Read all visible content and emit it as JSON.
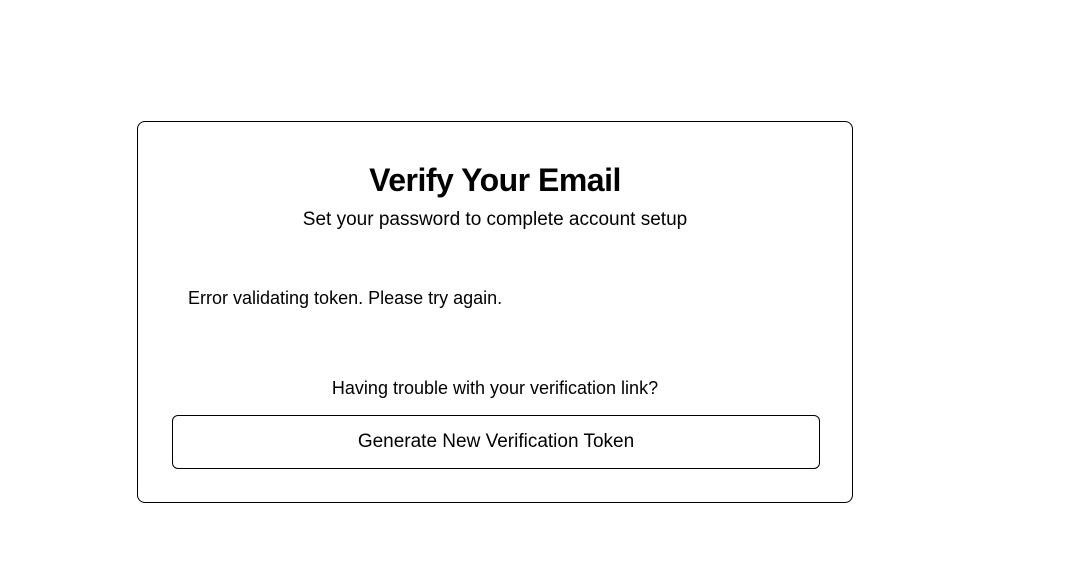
{
  "card": {
    "title": "Verify Your Email",
    "subtitle": "Set your password to complete account setup",
    "error_message": "Error validating token. Please try again.",
    "help_text": "Having trouble with your verification link?",
    "generate_button_label": "Generate New Verification Token"
  },
  "colors": {
    "text": "#000000",
    "border": "#000000",
    "background": "#ffffff"
  }
}
